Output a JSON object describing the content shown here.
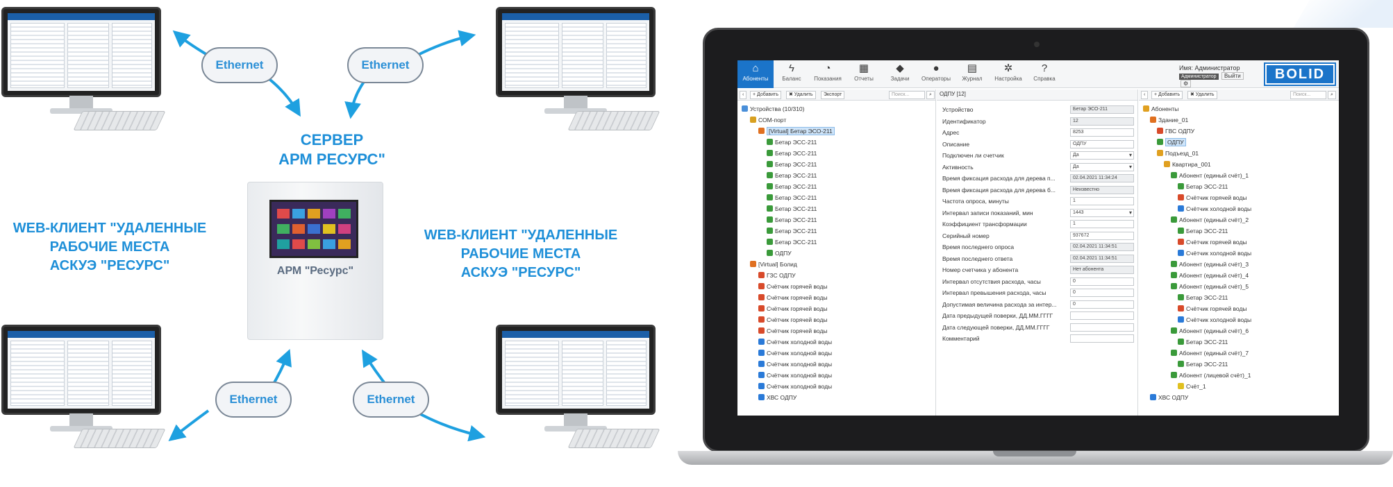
{
  "diagram": {
    "cloud_label": "Ethernet",
    "server_title_line1": "СЕРВЕР",
    "server_title_line2": "АРМ РЕСУРС\"",
    "server_caption": "АРМ \"Ресурс\"",
    "web_client_left": [
      "WEB-КЛИЕНТ \"УДАЛЕННЫЕ",
      "РАБОЧИЕ МЕСТА",
      "АСКУЭ \"РЕСУРС\""
    ],
    "web_client_right": [
      "WEB-КЛИЕНТ \"УДАЛЕННЫЕ",
      "РАБОЧИЕ МЕСТА",
      "АСКУЭ \"РЕСУРС\""
    ],
    "accent_color": "#1e8fd8"
  },
  "app": {
    "toolbar": [
      {
        "icon": "home-icon",
        "glyph": "⌂",
        "label": "Абоненты",
        "active": true
      },
      {
        "icon": "lightning-icon",
        "glyph": "ϟ",
        "label": "Баланс",
        "active": false
      },
      {
        "icon": "gauge-icon",
        "glyph": "◔",
        "label": "Показания",
        "active": false
      },
      {
        "icon": "calendar-icon",
        "glyph": "▦",
        "label": "Отчеты",
        "active": false
      },
      {
        "icon": "tags-icon",
        "glyph": "◆",
        "label": "Задачи",
        "active": false
      },
      {
        "icon": "person-icon",
        "glyph": "●",
        "label": "Операторы",
        "active": false
      },
      {
        "icon": "journal-icon",
        "glyph": "▤",
        "label": "Журнал",
        "active": false
      },
      {
        "icon": "gear-icon",
        "glyph": "✲",
        "label": "Настройка",
        "active": false
      },
      {
        "icon": "help-icon",
        "glyph": "?",
        "label": "Справка",
        "active": false
      }
    ],
    "user": {
      "name_label": "Имя: Администратор",
      "role": "Администратор",
      "logout": "Выйти"
    },
    "logo": "BOLID",
    "left_panel": {
      "buttons": [
        "‹",
        "+ Добавить",
        "✖ Удалить",
        "Экспорт"
      ],
      "search_placeholder": "Поиск...",
      "tree": [
        {
          "label": "Устройства (10/310)",
          "level": 0,
          "color": "#4a8fd9"
        },
        {
          "label": "СОМ-порт",
          "level": 1,
          "color": "#d8a020"
        },
        {
          "label": "[Virtual] Бетар ЭСО-211",
          "level": 2,
          "color": "#e07020",
          "selected": true
        },
        {
          "label": "Бетар ЭСС-211",
          "level": 3,
          "color": "#3a9a3a"
        },
        {
          "label": "Бетар ЭСС-211",
          "level": 3,
          "color": "#3a9a3a"
        },
        {
          "label": "Бетар ЭСС-211",
          "level": 3,
          "color": "#3a9a3a"
        },
        {
          "label": "Бетар ЭСС-211",
          "level": 3,
          "color": "#3a9a3a"
        },
        {
          "label": "Бетар ЭСС-211",
          "level": 3,
          "color": "#3a9a3a"
        },
        {
          "label": "Бетар ЭСС-211",
          "level": 3,
          "color": "#3a9a3a"
        },
        {
          "label": "Бетар ЭСС-211",
          "level": 3,
          "color": "#3a9a3a"
        },
        {
          "label": "Бетар ЭСС-211",
          "level": 3,
          "color": "#3a9a3a"
        },
        {
          "label": "Бетар ЭСС-211",
          "level": 3,
          "color": "#3a9a3a"
        },
        {
          "label": "Бетар ЭСС-211",
          "level": 3,
          "color": "#3a9a3a"
        },
        {
          "label": "ОДПУ",
          "level": 3,
          "color": "#3a9a3a"
        },
        {
          "label": "[Virtual] Болид",
          "level": 1,
          "color": "#e07020"
        },
        {
          "label": "ГЗС ОДПУ",
          "level": 2,
          "color": "#d84a2a"
        },
        {
          "label": "Счётчик горячей воды",
          "level": 2,
          "color": "#d84a2a"
        },
        {
          "label": "Счётчик горячей воды",
          "level": 2,
          "color": "#d84a2a"
        },
        {
          "label": "Счётчик горячей воды",
          "level": 2,
          "color": "#d84a2a"
        },
        {
          "label": "Счётчик горячей воды",
          "level": 2,
          "color": "#d84a2a"
        },
        {
          "label": "Счётчик горячей воды",
          "level": 2,
          "color": "#d84a2a"
        },
        {
          "label": "Счётчик холодной воды",
          "level": 2,
          "color": "#2a7ad8"
        },
        {
          "label": "Счётчик холодной воды",
          "level": 2,
          "color": "#2a7ad8"
        },
        {
          "label": "Счётчик холодной воды",
          "level": 2,
          "color": "#2a7ad8"
        },
        {
          "label": "Счётчик холодной воды",
          "level": 2,
          "color": "#2a7ad8"
        },
        {
          "label": "Счётчик холодной воды",
          "level": 2,
          "color": "#2a7ad8"
        },
        {
          "label": "ХВС ОДПУ",
          "level": 2,
          "color": "#2a7ad8"
        }
      ]
    },
    "middle_panel": {
      "title": "ОДПУ [12]",
      "props": [
        {
          "key": "Устройство",
          "value": "Бетар ЭСО-211",
          "kind": "ro"
        },
        {
          "key": "Идентификатор",
          "value": "12",
          "kind": "ro"
        },
        {
          "key": "Адрес",
          "value": "8253",
          "kind": "edit"
        },
        {
          "key": "Описание",
          "value": "ОДПУ",
          "kind": "edit"
        },
        {
          "key": "Подключен ли счетчик",
          "value": "Да",
          "kind": "dd"
        },
        {
          "key": "Активность",
          "value": "Да",
          "kind": "dd"
        },
        {
          "key": "Время фиксация расхода для дерева п...",
          "value": "02.04.2021 11:34:24",
          "kind": "ro"
        },
        {
          "key": "Время фиксация расхода для дерева б...",
          "value": "Неизвестно",
          "kind": "ro"
        },
        {
          "key": "Частота опроса, минуты",
          "value": "1",
          "kind": "edit"
        },
        {
          "key": "Интервал записи показаний, мин",
          "value": "1443",
          "kind": "dd"
        },
        {
          "key": "Коэффициент трансформации",
          "value": "1",
          "kind": "edit"
        },
        {
          "key": "Серийный номер",
          "value": "937672",
          "kind": "edit"
        },
        {
          "key": "Время последнего опроса",
          "value": "02.04.2021 11:34:51",
          "kind": "ro"
        },
        {
          "key": "Время последнего ответа",
          "value": "02.04.2021 11:34:51",
          "kind": "ro"
        },
        {
          "key": "Номер счетчика у абонента",
          "value": "Нет абонента",
          "kind": "ro"
        },
        {
          "key": "Интервал отсутствия расхода, часы",
          "value": "0",
          "kind": "edit"
        },
        {
          "key": "Интервал превышения расхода, часы",
          "value": "0",
          "kind": "edit"
        },
        {
          "key": "Допустимая величина расхода за интер...",
          "value": "0",
          "kind": "edit"
        },
        {
          "key": "Дата предыдущей поверки, ДД.ММ.ГГГГ",
          "value": "",
          "kind": "edit"
        },
        {
          "key": "Дата следующей поверки, ДД.ММ.ГГГГ",
          "value": "",
          "kind": "edit"
        },
        {
          "key": "Комментарий",
          "value": "",
          "kind": "edit"
        }
      ]
    },
    "right_panel": {
      "buttons": [
        "‹",
        "+ Добавить",
        "✖ Удалить"
      ],
      "search_placeholder": "Поиск...",
      "tree": [
        {
          "label": "Абоненты",
          "level": 0,
          "color": "#e0a020"
        },
        {
          "label": "Здание_01",
          "level": 1,
          "color": "#e07020"
        },
        {
          "label": "ГВС ОДПУ",
          "level": 2,
          "color": "#d84a2a"
        },
        {
          "label": "ОДПУ",
          "level": 2,
          "color": "#3a9a3a",
          "selected": true
        },
        {
          "label": "Подъезд_01",
          "level": 2,
          "color": "#e0a020"
        },
        {
          "label": "Квартира_001",
          "level": 3,
          "color": "#e0a020"
        },
        {
          "label": "Абонент (единый счёт)_1",
          "level": 4,
          "color": "#3a9a3a"
        },
        {
          "label": "Бетар ЭСС-211",
          "level": 5,
          "color": "#3a9a3a"
        },
        {
          "label": "Счётчик горячей воды",
          "level": 5,
          "color": "#d84a2a"
        },
        {
          "label": "Счётчик холодной воды",
          "level": 5,
          "color": "#2a7ad8"
        },
        {
          "label": "Абонент (единый счёт)_2",
          "level": 4,
          "color": "#3a9a3a"
        },
        {
          "label": "Бетар ЭСС-211",
          "level": 5,
          "color": "#3a9a3a"
        },
        {
          "label": "Счётчик горячей воды",
          "level": 5,
          "color": "#d84a2a"
        },
        {
          "label": "Счётчик холодной воды",
          "level": 5,
          "color": "#2a7ad8"
        },
        {
          "label": "Абонент (единый счёт)_3",
          "level": 4,
          "color": "#3a9a3a"
        },
        {
          "label": "Абонент (единый счёт)_4",
          "level": 4,
          "color": "#3a9a3a"
        },
        {
          "label": "Абонент (единый счёт)_5",
          "level": 4,
          "color": "#3a9a3a"
        },
        {
          "label": "Бетар ЭСС-211",
          "level": 5,
          "color": "#3a9a3a"
        },
        {
          "label": "Счётчик горячей воды",
          "level": 5,
          "color": "#d84a2a"
        },
        {
          "label": "Счётчик холодной воды",
          "level": 5,
          "color": "#2a7ad8"
        },
        {
          "label": "Абонент (единый счёт)_6",
          "level": 4,
          "color": "#3a9a3a"
        },
        {
          "label": "Бетар ЭСС-211",
          "level": 5,
          "color": "#3a9a3a"
        },
        {
          "label": "Абонент (единый счёт)_7",
          "level": 4,
          "color": "#3a9a3a"
        },
        {
          "label": "Бетар ЭСС-211",
          "level": 5,
          "color": "#3a9a3a"
        },
        {
          "label": "Абонент (лицевой счёт)_1",
          "level": 4,
          "color": "#3a9a3a"
        },
        {
          "label": "Счёт_1",
          "level": 5,
          "color": "#e0c020"
        },
        {
          "label": "ХВС ОДПУ",
          "level": 1,
          "color": "#2a7ad8"
        }
      ]
    }
  }
}
